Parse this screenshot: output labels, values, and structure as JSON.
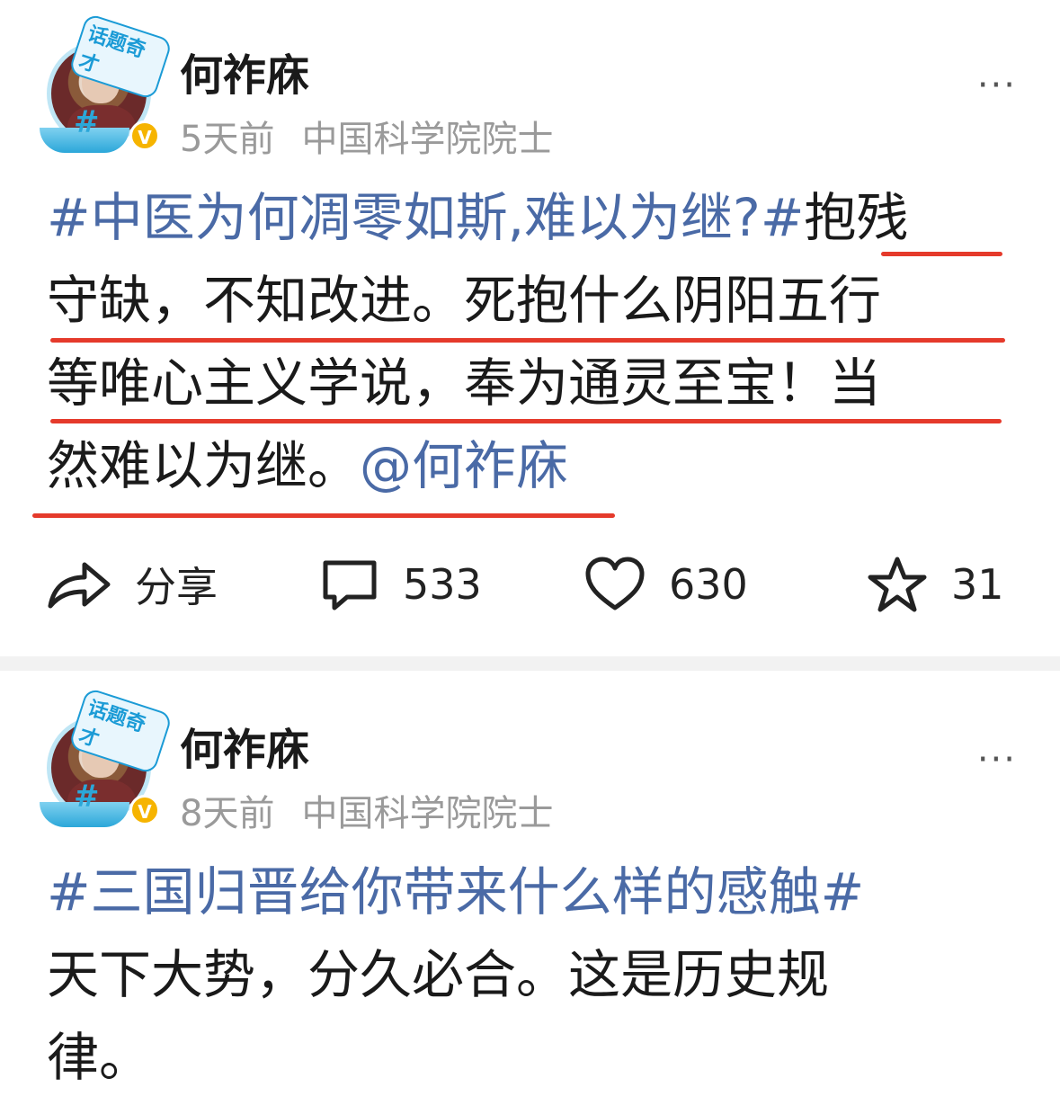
{
  "posts": [
    {
      "author": "何祚庥",
      "time": "5天前",
      "verified_title": "中国科学院院士",
      "badge": "话题奇才",
      "more": "···",
      "lines": [
        {
          "topic": "#中医为何凋零如斯,难以为继?#",
          "text": "抱残"
        },
        {
          "text": "守缺，不知改进。死抱什么阴阳五行"
        },
        {
          "text": "等唯心主义学说，奉为通灵至宝！当"
        },
        {
          "text": "然难以为继。",
          "mention": "@何祚庥"
        }
      ],
      "actions": {
        "share": "分享",
        "comments": "533",
        "likes": "630",
        "favorites": "31"
      }
    },
    {
      "author": "何祚庥",
      "time": "8天前",
      "verified_title": "中国科学院院士",
      "badge": "话题奇才",
      "more": "···",
      "lines": [
        {
          "topic": "#三国归晋给你带来什么样的感触#"
        },
        {
          "text": "天下大势，分久必合。这是历史规"
        },
        {
          "text": "律。"
        }
      ]
    }
  ],
  "colors": {
    "topic": "#4a6aa6",
    "underline": "#e53a2b",
    "meta": "#9a9a9a",
    "divider": "#f2f2f2",
    "verified": "#f6b400"
  }
}
